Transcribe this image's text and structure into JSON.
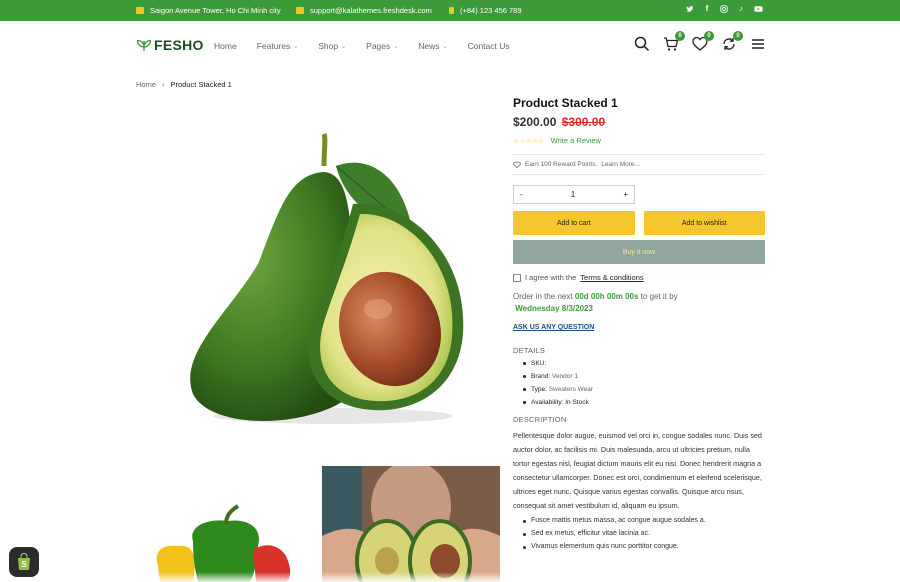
{
  "topbar": {
    "address": "Saigon Avenue Tower, Ho Chi Minh city",
    "email": "support@kalathemes.freshdesk.com",
    "phone": "(+84) 123 456 789",
    "social_icons": [
      "twitter-icon",
      "facebook-icon",
      "instagram-icon",
      "tiktok-icon",
      "youtube-icon"
    ]
  },
  "header": {
    "logo": "FESHO",
    "nav": [
      {
        "label": "Home"
      },
      {
        "label": "Features"
      },
      {
        "label": "Shop"
      },
      {
        "label": "Pages"
      },
      {
        "label": "News"
      },
      {
        "label": "Contact Us"
      }
    ],
    "cart_count": "0",
    "wishlist_count": "0",
    "compare_count": "0"
  },
  "breadcrumb": {
    "home": "Home",
    "current": "Product Stacked 1"
  },
  "product": {
    "title": "Product Stacked 1",
    "price": "$200.00",
    "old_price": "$300.00",
    "stars": "☆☆☆☆☆",
    "review_link": "Write a Review",
    "reward": "Earn 100 Reward Points.",
    "learn_more": "Learn More...",
    "qty_minus": "-",
    "qty_value": "1",
    "qty_plus": "+",
    "add_to_cart": "Add to cart",
    "add_to_wishlist": "Add to wishlist",
    "buy_now": "Buy it now",
    "agree_text": "I agree with the",
    "terms": "Terms & conditions",
    "order_prefix": "Order in the next",
    "countdown": "00d 00h 00m 00s",
    "order_mid": "to get it by",
    "delivery_date": "Wednesday 8/3/2023",
    "ask": "ASK US ANY QUESTION"
  },
  "details": {
    "heading": "DETAILS",
    "sku_label": "SKU:",
    "brand_label": "Brand:",
    "brand_value": "Vendor 1",
    "type_label": "Type:",
    "type_value": "Sweaters Wear",
    "availability_label": "Availability:",
    "availability_value": "In Stock"
  },
  "description": {
    "heading": "DESCRIPTION",
    "text": "Pellentesque dolor augue, euismod vel orci in, congue sodales nunc. Duis sed auctor dolor, ac facilisis mi. Duis malesuada, arcu ut ultricies pretium, nulla tortor egestas nisl, feugiat dictum mauris elit eu nisi. Donec hendrerit magna a consectetur ullamcorper. Donec est orci, condimentum et eleifend scelerisque, ultrices eget nunc. Quisque varius egestas convallis. Quisque arcu risus, consequat sit amet vestibulum id, aliquam eu ipsum.",
    "bullets": [
      "Fusce mattis metus massa, ac congue augue sodales a.",
      "Sed ex metus, efficitur vitae lacinia ac.",
      "Vivamus elementum quis nunc porttitor congue."
    ]
  },
  "colors": {
    "brand_green": "#3d9a3b",
    "accent_yellow": "#f6c62e",
    "sale_red": "#e02b27",
    "buy_button": "#91a79d"
  }
}
